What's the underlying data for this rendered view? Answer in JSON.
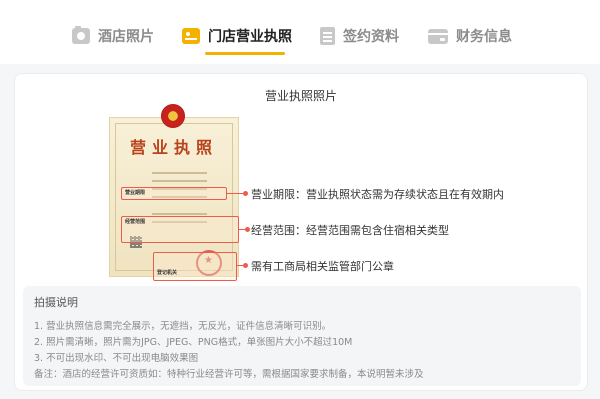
{
  "tabs": [
    {
      "label": "酒店照片",
      "icon": "camera-icon",
      "active": false
    },
    {
      "label": "门店营业执照",
      "icon": "license-icon",
      "active": true
    },
    {
      "label": "签约资料",
      "icon": "document-icon",
      "active": false
    },
    {
      "label": "财务信息",
      "icon": "wallet-icon",
      "active": false
    }
  ],
  "colors": {
    "accent": "#f5b100",
    "highlight": "#f05a4a",
    "inactive_tab": "#8c8c8c"
  },
  "card": {
    "title": "营业执照照片"
  },
  "license_sample": {
    "title": "营业执照",
    "field_term": "营业期限",
    "field_scope": "经营范围",
    "field_authority": "登记机关"
  },
  "annotations": [
    {
      "text": "营业期限：营业执照状态需为存续状态且在有效期内"
    },
    {
      "text": "经营范围：经营范围需包含住宿相关类型"
    },
    {
      "text": "需有工商局相关监管部门公章"
    }
  ],
  "tips": {
    "title": "拍摄说明",
    "lines": [
      "1. 营业执照信息需完全展示，无遮挡，无反光，证件信息清晰可识别。",
      "2. 照片需清晰，照片需为JPG、JPEG、PNG格式，单张图片大小不超过10M",
      "3. 不可出现水印、不可出现电脑效果图",
      "备注：酒店的经营许可资质如：特种行业经营许可等，需根据国家要求制备，本说明暂未涉及"
    ]
  }
}
